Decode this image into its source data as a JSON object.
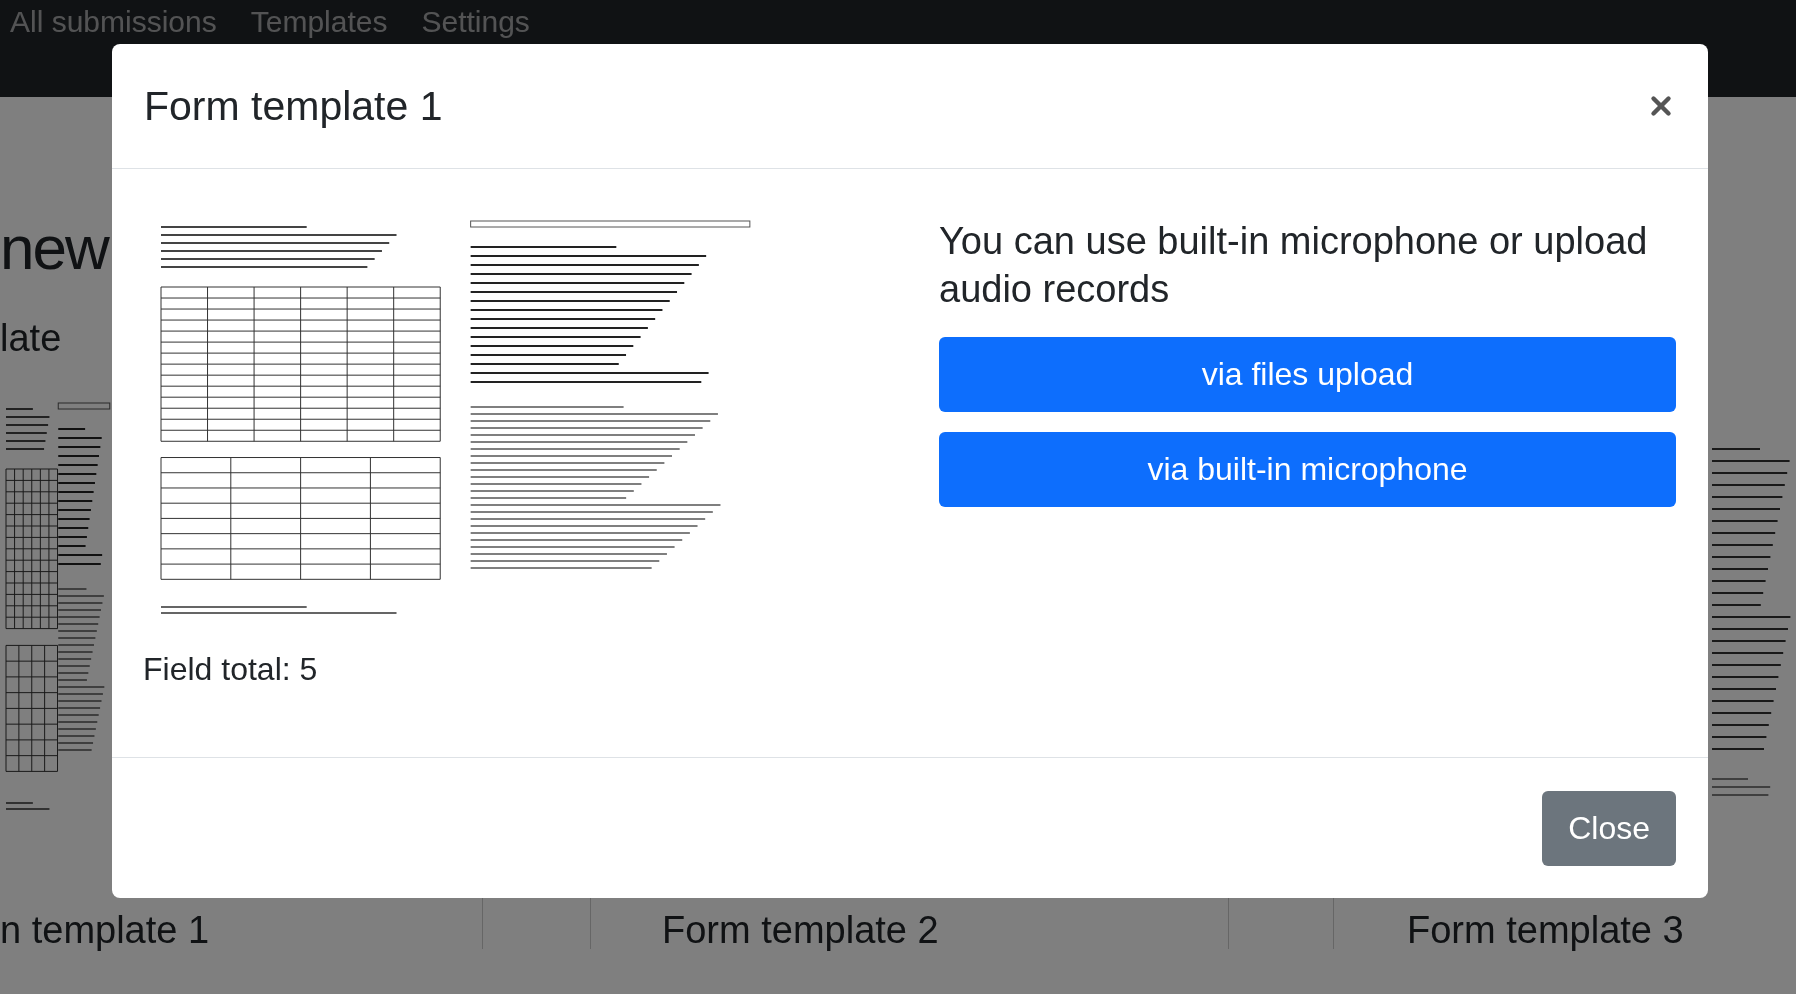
{
  "navbar": {
    "links": [
      {
        "label": "All submissions"
      },
      {
        "label": "Templates"
      },
      {
        "label": "Settings"
      }
    ]
  },
  "page": {
    "heading_fragment": "new",
    "subheading_fragment": "late",
    "cards": [
      {
        "title": "n template 1"
      },
      {
        "title": "Form template 2"
      },
      {
        "title": "Form template 3"
      }
    ]
  },
  "modal": {
    "title": "Form template 1",
    "preview": {
      "kind": "picture"
    },
    "field_total": "Field total: 5",
    "prompt": "You can use built-in microphone or upload audio records",
    "actions": [
      "via files upload",
      "via built-in microphone"
    ],
    "footer_button": "Close"
  }
}
